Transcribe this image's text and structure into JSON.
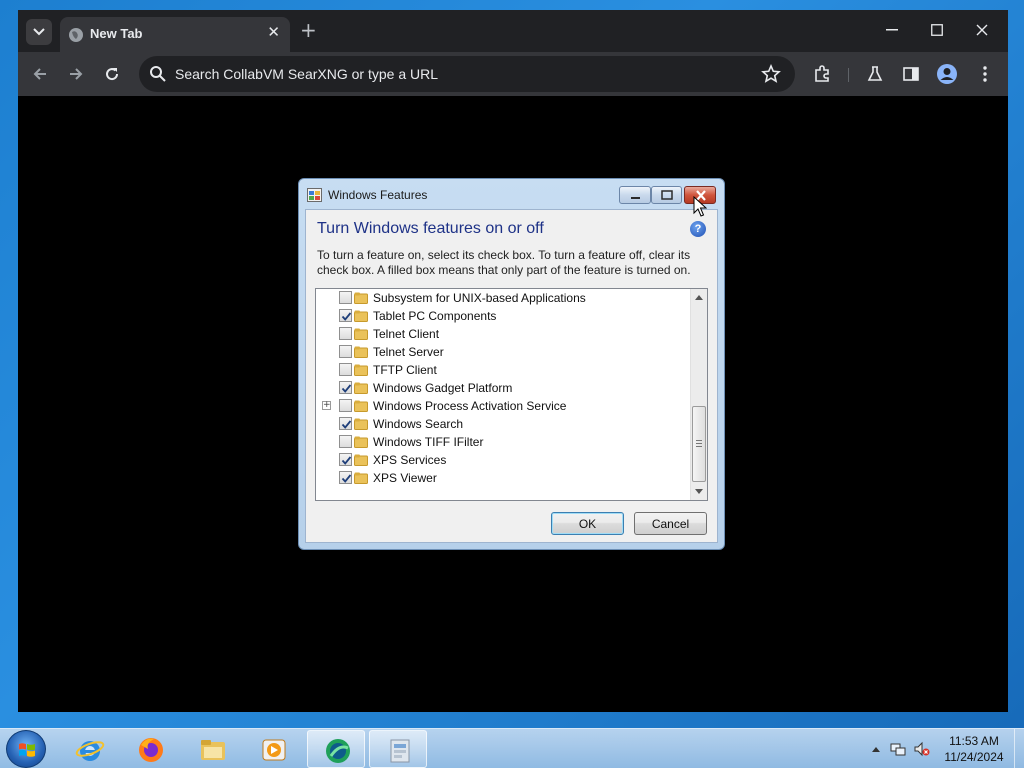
{
  "browser": {
    "tab_title": "New Tab",
    "tab_close": "✕",
    "new_tab": "+",
    "omnibox_placeholder": "Search CollabVM SearXNG or type a URL",
    "icons": [
      "tab-search-icon",
      "globe-icon",
      "back-arrow-icon",
      "forward-arrow-icon",
      "reload-icon",
      "search-icon",
      "star-icon",
      "extensions-icon",
      "labs-flask-icon",
      "side-panel-icon",
      "profile-icon",
      "more-menu-icon",
      "minimize-icon",
      "maximize-icon",
      "close-icon"
    ],
    "theme": {
      "frame": "#202124",
      "toolbar": "#35363a",
      "text": "#e8eaed"
    }
  },
  "dialog": {
    "title": "Windows Features",
    "heading": "Turn Windows features on or off",
    "help": "?",
    "description": "To turn a feature on, select its check box. To turn a feature off, clear its check box. A filled box means that only part of the feature is turned on.",
    "features": [
      {
        "label": "Subsystem for UNIX-based Applications",
        "checked": false,
        "expandable": false
      },
      {
        "label": "Tablet PC Components",
        "checked": true,
        "expandable": false
      },
      {
        "label": "Telnet Client",
        "checked": false,
        "expandable": false
      },
      {
        "label": "Telnet Server",
        "checked": false,
        "expandable": false
      },
      {
        "label": "TFTP Client",
        "checked": false,
        "expandable": false
      },
      {
        "label": "Windows Gadget Platform",
        "checked": true,
        "expandable": false
      },
      {
        "label": "Windows Process Activation Service",
        "checked": false,
        "expandable": true
      },
      {
        "label": "Windows Search",
        "checked": true,
        "expandable": false
      },
      {
        "label": "Windows TIFF IFilter",
        "checked": false,
        "expandable": false
      },
      {
        "label": "XPS Services",
        "checked": true,
        "expandable": false
      },
      {
        "label": "XPS Viewer",
        "checked": true,
        "expandable": false
      }
    ],
    "expander_symbol": "+",
    "ok_label": "OK",
    "cancel_label": "Cancel",
    "heading_color": "#1e3287"
  },
  "taskbar": {
    "apps": [
      "internet-explorer-icon",
      "firefox-icon",
      "file-explorer-icon",
      "media-player-icon",
      "chrome-browser-icon",
      "control-panel-icon"
    ],
    "active_apps": [
      "chrome-browser-icon",
      "control-panel-icon"
    ],
    "clock_time": "11:53 AM",
    "clock_date": "11/24/2024"
  }
}
